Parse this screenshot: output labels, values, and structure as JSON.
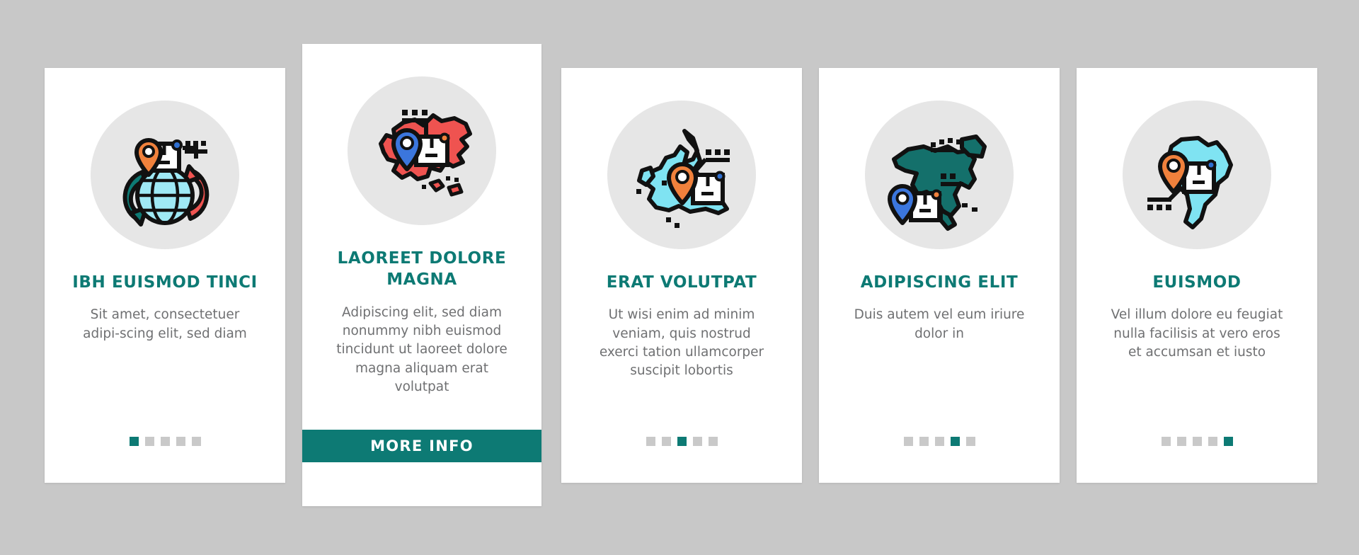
{
  "page": {
    "background_color": "#c8c8c8",
    "accent_color": "#0d7a74",
    "title_color": "#0d7a74",
    "body_text_color": "#6f7072",
    "dot_inactive_color": "#c9c9c9",
    "icon_disc_color": "#e6e6e6"
  },
  "cards": [
    {
      "id": "card-1",
      "icon_name": "globe-delivery-icon",
      "title": "IBH EUISMOD TINCI",
      "description": "Sit amet, consectetuer adipi-scing elit, sed diam",
      "description_lines": [
        "Sit amet, consectetuer adipi-",
        "scing elit, sed diam"
      ],
      "dots": {
        "total": 5,
        "active_index": 0
      },
      "has_cta": false,
      "cta_label": ""
    },
    {
      "id": "card-2",
      "icon_name": "asia-map-delivery-icon",
      "title": "LAOREET DOLORE MAGNA",
      "description": "Adipiscing elit, sed diam nonummy nibh euismod tincidunt ut laoreet dolore magna aliquam erat volutpat",
      "description_lines": [
        "Adipiscing elit, sed diam",
        "nonummy nibh euismod tinci-",
        "dunt ut laoreet dolore magna",
        "aliquam erat volutpat"
      ],
      "dots": {
        "total": 5,
        "active_index": 1
      },
      "has_cta": true,
      "cta_label": "MORE INFO"
    },
    {
      "id": "card-3",
      "icon_name": "europe-map-delivery-icon",
      "title": "ERAT VOLUTPAT",
      "description": "Ut wisi enim ad minim veniam, quis nostrud exerci tation ullamcorper suscipit lobortis",
      "description_lines": [
        "Ut wisi enim ad minim veniam,",
        "quis nostrud exerci tation ulla-",
        "mcorper suscipit lobortis"
      ],
      "dots": {
        "total": 5,
        "active_index": 2
      },
      "has_cta": false,
      "cta_label": ""
    },
    {
      "id": "card-4",
      "icon_name": "north-america-map-delivery-icon",
      "title": "ADIPISCING ELIT",
      "description": "Duis autem vel eum iriure dolor in",
      "description_lines": [
        "Duis autem vel eum iriure",
        "dolor in"
      ],
      "dots": {
        "total": 5,
        "active_index": 3
      },
      "has_cta": false,
      "cta_label": ""
    },
    {
      "id": "card-5",
      "icon_name": "south-america-map-delivery-icon",
      "title": "EUISMOD",
      "description": "Vel illum dolore eu feugiat nulla facilisis at vero eros et accumsan et iusto",
      "description_lines": [
        "Vel illum dolore eu feugiat",
        "nulla facilisis at vero eros et",
        "accumsan et iusto"
      ],
      "dots": {
        "total": 5,
        "active_index": 4
      },
      "has_cta": false,
      "cta_label": ""
    }
  ]
}
